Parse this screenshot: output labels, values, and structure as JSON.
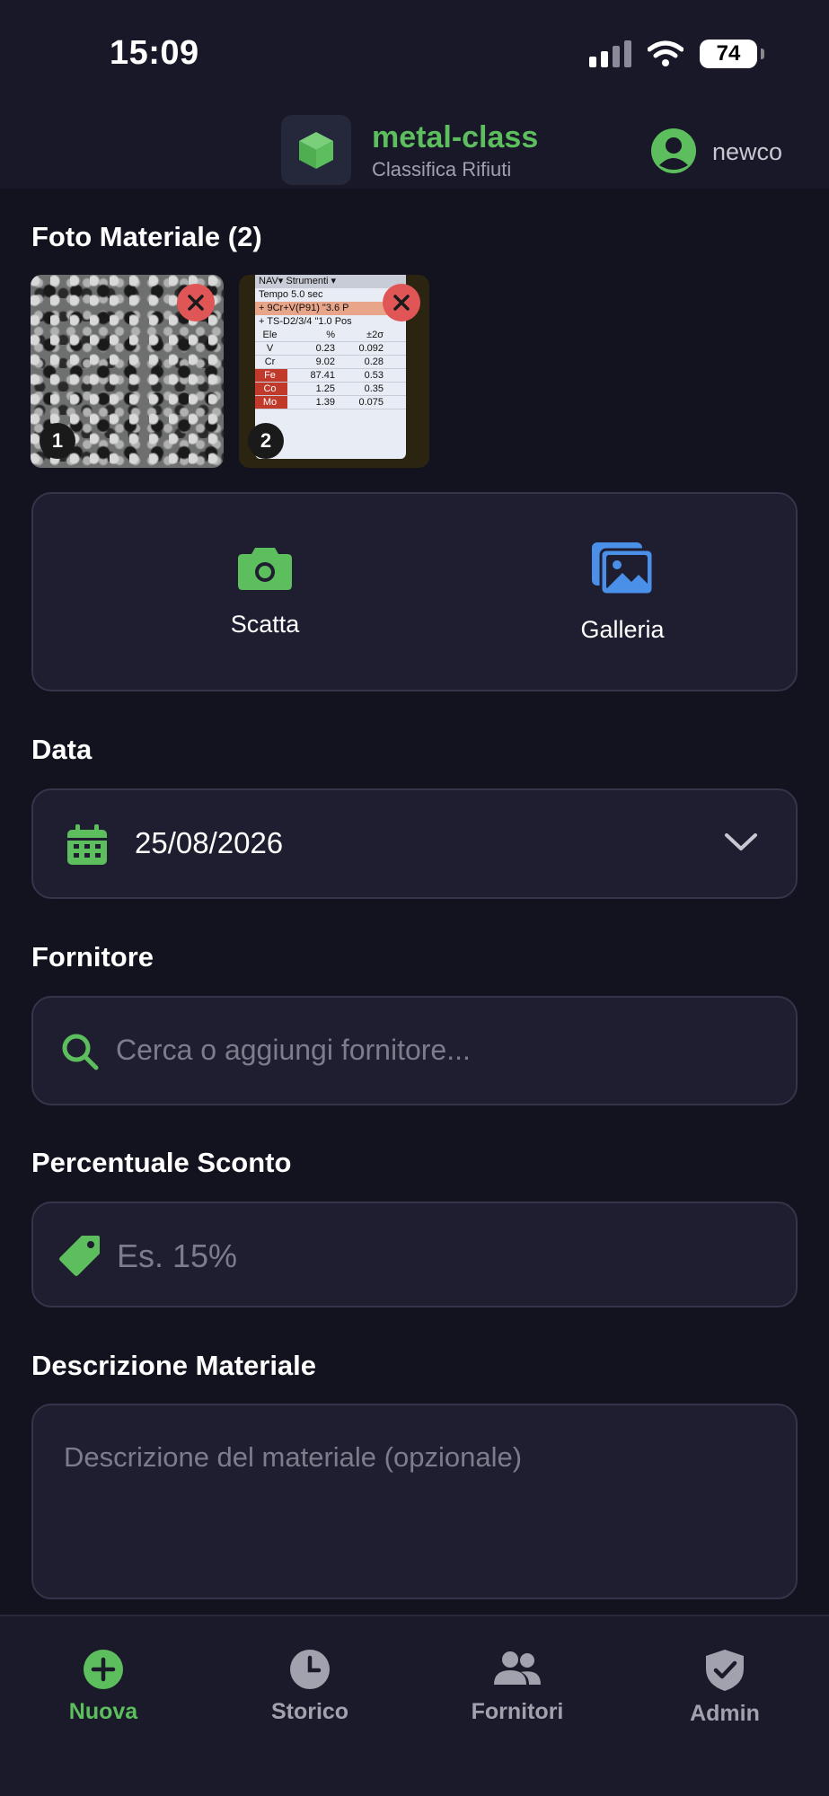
{
  "status": {
    "time": "15:09",
    "battery": "74"
  },
  "header": {
    "title": "metal-class",
    "subtitle": "Classifica Rifiuti",
    "user": "newco"
  },
  "photos": {
    "label": "Foto Materiale (2)",
    "items": [
      {
        "number": "1"
      },
      {
        "number": "2",
        "screen": {
          "menu": "NAV▾   Strumenti ▾",
          "time": "Tempo 5.0 sec",
          "alloy1": "+  9Cr+V(P91)      \"3.6 P",
          "alloy2": "+  TS-D2/3/4        \"1.0 Pos",
          "headers": [
            "Ele",
            "%",
            "±2σ"
          ],
          "rows": [
            [
              "V",
              "0.23",
              "0.092"
            ],
            [
              "Cr",
              "9.02",
              "0.28"
            ],
            [
              "Fe",
              "87.41",
              "0.53"
            ],
            [
              "Co",
              "1.25",
              "0.35"
            ],
            [
              "Mo",
              "1.39",
              "0.075"
            ]
          ]
        }
      }
    ]
  },
  "capture": {
    "camera_label": "Scatta",
    "gallery_label": "Galleria"
  },
  "date": {
    "label": "Data",
    "value": "25/08/2026"
  },
  "supplier": {
    "label": "Fornitore",
    "placeholder": "Cerca o aggiungi fornitore..."
  },
  "discount": {
    "label": "Percentuale Sconto",
    "placeholder": "Es. 15%"
  },
  "description": {
    "label": "Descrizione Materiale",
    "placeholder": "Descrizione del materiale (opzionale)"
  },
  "nav": {
    "items": [
      {
        "label": "Nuova",
        "icon": "plus-circle-icon",
        "active": true
      },
      {
        "label": "Storico",
        "icon": "clock-icon",
        "active": false
      },
      {
        "label": "Fornitori",
        "icon": "people-icon",
        "active": false
      },
      {
        "label": "Admin",
        "icon": "shield-icon",
        "active": false
      }
    ]
  },
  "colors": {
    "accent": "#5cbe5c",
    "gallery": "#4a8fe8",
    "remove": "#e05656",
    "background": "#13131f",
    "card": "#1e1e30"
  }
}
